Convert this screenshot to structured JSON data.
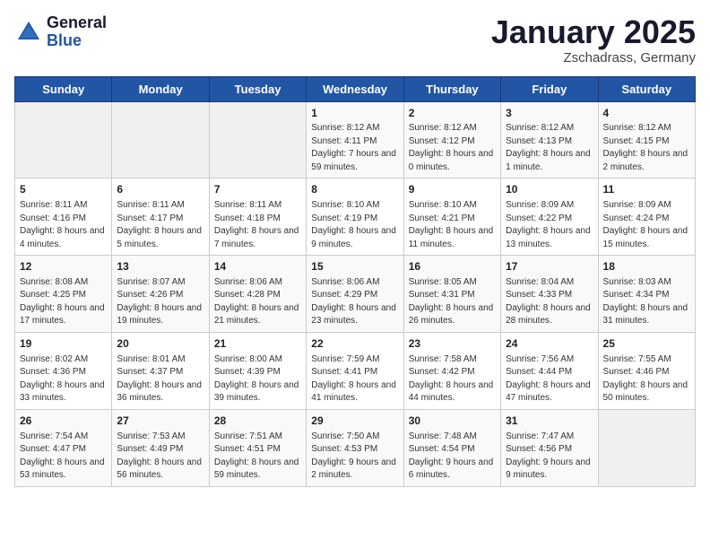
{
  "header": {
    "logo_general": "General",
    "logo_blue": "Blue",
    "month_year": "January 2025",
    "location": "Zschadrass, Germany"
  },
  "weekdays": [
    "Sunday",
    "Monday",
    "Tuesday",
    "Wednesday",
    "Thursday",
    "Friday",
    "Saturday"
  ],
  "weeks": [
    [
      {
        "day": "",
        "empty": true
      },
      {
        "day": "",
        "empty": true
      },
      {
        "day": "",
        "empty": true
      },
      {
        "day": "1",
        "sunrise": "Sunrise: 8:12 AM",
        "sunset": "Sunset: 4:11 PM",
        "daylight": "Daylight: 7 hours and 59 minutes."
      },
      {
        "day": "2",
        "sunrise": "Sunrise: 8:12 AM",
        "sunset": "Sunset: 4:12 PM",
        "daylight": "Daylight: 8 hours and 0 minutes."
      },
      {
        "day": "3",
        "sunrise": "Sunrise: 8:12 AM",
        "sunset": "Sunset: 4:13 PM",
        "daylight": "Daylight: 8 hours and 1 minute."
      },
      {
        "day": "4",
        "sunrise": "Sunrise: 8:12 AM",
        "sunset": "Sunset: 4:15 PM",
        "daylight": "Daylight: 8 hours and 2 minutes."
      }
    ],
    [
      {
        "day": "5",
        "sunrise": "Sunrise: 8:11 AM",
        "sunset": "Sunset: 4:16 PM",
        "daylight": "Daylight: 8 hours and 4 minutes."
      },
      {
        "day": "6",
        "sunrise": "Sunrise: 8:11 AM",
        "sunset": "Sunset: 4:17 PM",
        "daylight": "Daylight: 8 hours and 5 minutes."
      },
      {
        "day": "7",
        "sunrise": "Sunrise: 8:11 AM",
        "sunset": "Sunset: 4:18 PM",
        "daylight": "Daylight: 8 hours and 7 minutes."
      },
      {
        "day": "8",
        "sunrise": "Sunrise: 8:10 AM",
        "sunset": "Sunset: 4:19 PM",
        "daylight": "Daylight: 8 hours and 9 minutes."
      },
      {
        "day": "9",
        "sunrise": "Sunrise: 8:10 AM",
        "sunset": "Sunset: 4:21 PM",
        "daylight": "Daylight: 8 hours and 11 minutes."
      },
      {
        "day": "10",
        "sunrise": "Sunrise: 8:09 AM",
        "sunset": "Sunset: 4:22 PM",
        "daylight": "Daylight: 8 hours and 13 minutes."
      },
      {
        "day": "11",
        "sunrise": "Sunrise: 8:09 AM",
        "sunset": "Sunset: 4:24 PM",
        "daylight": "Daylight: 8 hours and 15 minutes."
      }
    ],
    [
      {
        "day": "12",
        "sunrise": "Sunrise: 8:08 AM",
        "sunset": "Sunset: 4:25 PM",
        "daylight": "Daylight: 8 hours and 17 minutes."
      },
      {
        "day": "13",
        "sunrise": "Sunrise: 8:07 AM",
        "sunset": "Sunset: 4:26 PM",
        "daylight": "Daylight: 8 hours and 19 minutes."
      },
      {
        "day": "14",
        "sunrise": "Sunrise: 8:06 AM",
        "sunset": "Sunset: 4:28 PM",
        "daylight": "Daylight: 8 hours and 21 minutes."
      },
      {
        "day": "15",
        "sunrise": "Sunrise: 8:06 AM",
        "sunset": "Sunset: 4:29 PM",
        "daylight": "Daylight: 8 hours and 23 minutes."
      },
      {
        "day": "16",
        "sunrise": "Sunrise: 8:05 AM",
        "sunset": "Sunset: 4:31 PM",
        "daylight": "Daylight: 8 hours and 26 minutes."
      },
      {
        "day": "17",
        "sunrise": "Sunrise: 8:04 AM",
        "sunset": "Sunset: 4:33 PM",
        "daylight": "Daylight: 8 hours and 28 minutes."
      },
      {
        "day": "18",
        "sunrise": "Sunrise: 8:03 AM",
        "sunset": "Sunset: 4:34 PM",
        "daylight": "Daylight: 8 hours and 31 minutes."
      }
    ],
    [
      {
        "day": "19",
        "sunrise": "Sunrise: 8:02 AM",
        "sunset": "Sunset: 4:36 PM",
        "daylight": "Daylight: 8 hours and 33 minutes."
      },
      {
        "day": "20",
        "sunrise": "Sunrise: 8:01 AM",
        "sunset": "Sunset: 4:37 PM",
        "daylight": "Daylight: 8 hours and 36 minutes."
      },
      {
        "day": "21",
        "sunrise": "Sunrise: 8:00 AM",
        "sunset": "Sunset: 4:39 PM",
        "daylight": "Daylight: 8 hours and 39 minutes."
      },
      {
        "day": "22",
        "sunrise": "Sunrise: 7:59 AM",
        "sunset": "Sunset: 4:41 PM",
        "daylight": "Daylight: 8 hours and 41 minutes."
      },
      {
        "day": "23",
        "sunrise": "Sunrise: 7:58 AM",
        "sunset": "Sunset: 4:42 PM",
        "daylight": "Daylight: 8 hours and 44 minutes."
      },
      {
        "day": "24",
        "sunrise": "Sunrise: 7:56 AM",
        "sunset": "Sunset: 4:44 PM",
        "daylight": "Daylight: 8 hours and 47 minutes."
      },
      {
        "day": "25",
        "sunrise": "Sunrise: 7:55 AM",
        "sunset": "Sunset: 4:46 PM",
        "daylight": "Daylight: 8 hours and 50 minutes."
      }
    ],
    [
      {
        "day": "26",
        "sunrise": "Sunrise: 7:54 AM",
        "sunset": "Sunset: 4:47 PM",
        "daylight": "Daylight: 8 hours and 53 minutes."
      },
      {
        "day": "27",
        "sunrise": "Sunrise: 7:53 AM",
        "sunset": "Sunset: 4:49 PM",
        "daylight": "Daylight: 8 hours and 56 minutes."
      },
      {
        "day": "28",
        "sunrise": "Sunrise: 7:51 AM",
        "sunset": "Sunset: 4:51 PM",
        "daylight": "Daylight: 8 hours and 59 minutes."
      },
      {
        "day": "29",
        "sunrise": "Sunrise: 7:50 AM",
        "sunset": "Sunset: 4:53 PM",
        "daylight": "Daylight: 9 hours and 2 minutes."
      },
      {
        "day": "30",
        "sunrise": "Sunrise: 7:48 AM",
        "sunset": "Sunset: 4:54 PM",
        "daylight": "Daylight: 9 hours and 6 minutes."
      },
      {
        "day": "31",
        "sunrise": "Sunrise: 7:47 AM",
        "sunset": "Sunset: 4:56 PM",
        "daylight": "Daylight: 9 hours and 9 minutes."
      },
      {
        "day": "",
        "empty": true
      }
    ]
  ]
}
